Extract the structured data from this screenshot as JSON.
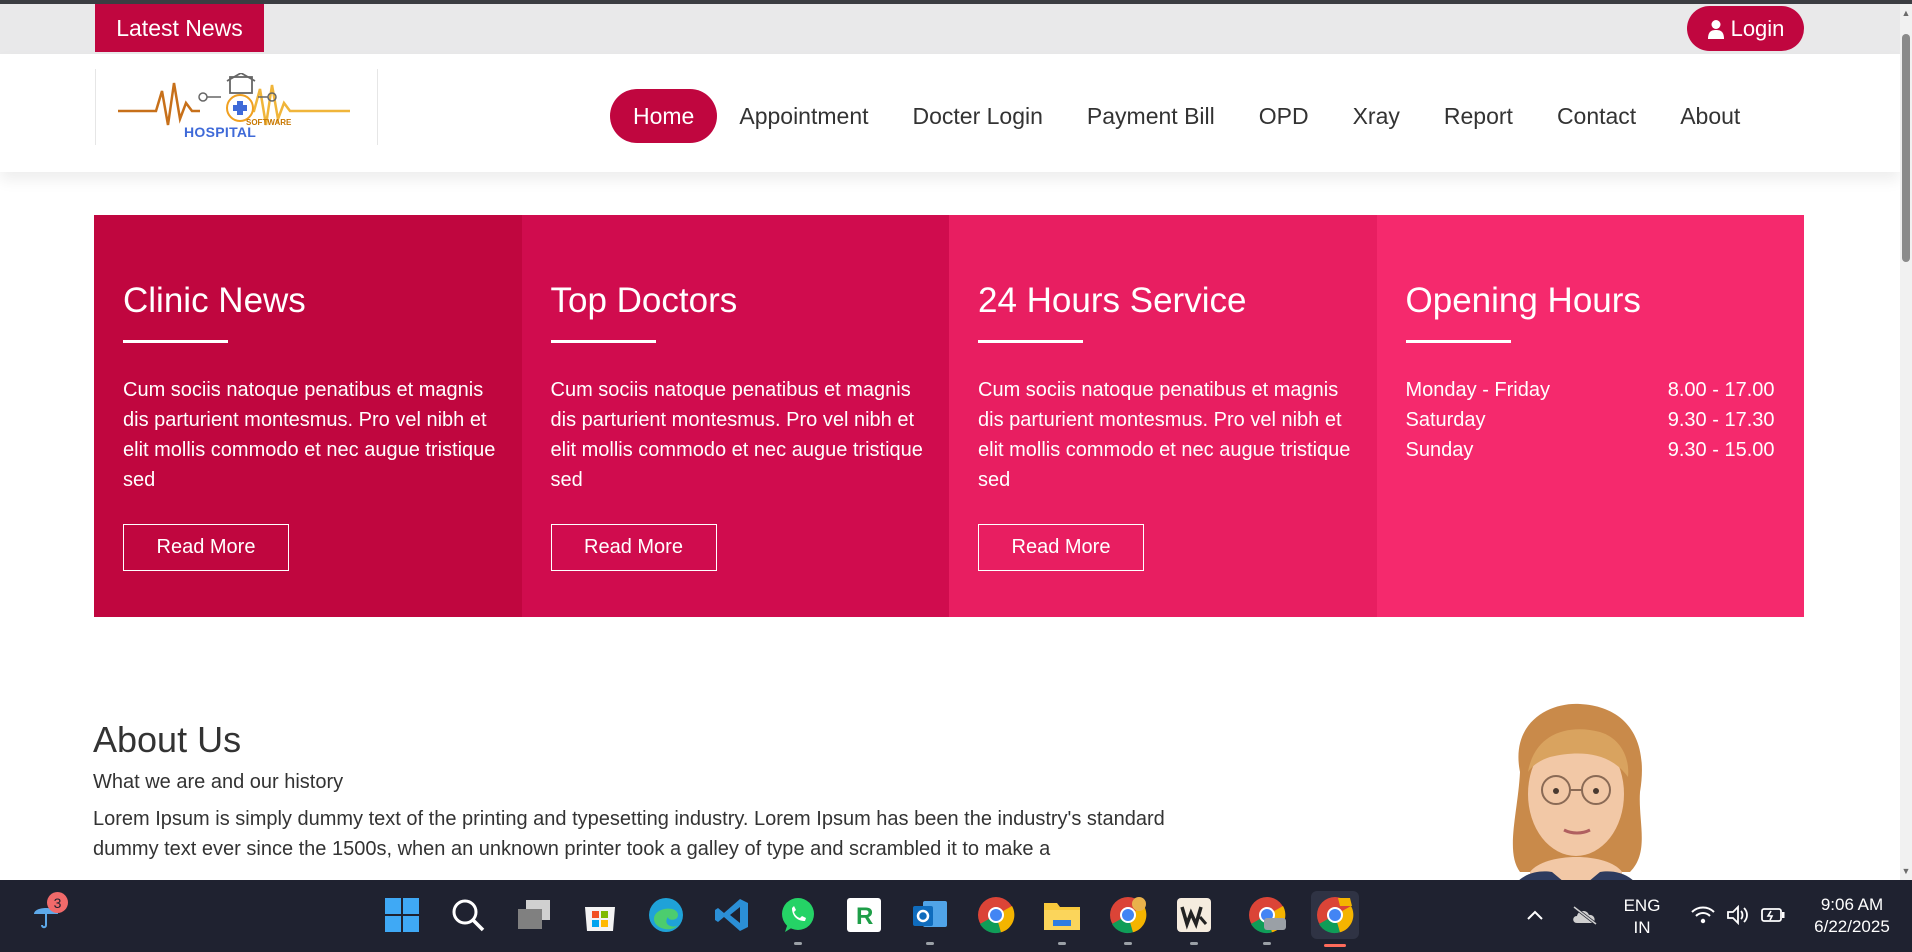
{
  "topbar": {
    "latest_news": "Latest News",
    "login": "Login"
  },
  "logo": {
    "word_main": "HOSPITAL",
    "word_sub": "SOFTWARE"
  },
  "nav": {
    "items": [
      {
        "label": "Home",
        "active": true
      },
      {
        "label": "Appointment",
        "active": false
      },
      {
        "label": "Docter Login",
        "active": false
      },
      {
        "label": "Payment Bill",
        "active": false
      },
      {
        "label": "OPD",
        "active": false
      },
      {
        "label": "Xray",
        "active": false
      },
      {
        "label": "Report",
        "active": false
      },
      {
        "label": "Contact",
        "active": false
      },
      {
        "label": "About",
        "active": false
      }
    ]
  },
  "features": [
    {
      "title": "Clinic News",
      "text": "Cum sociis natoque penatibus et magnis dis parturient montesmus. Pro vel nibh et elit mollis commodo et nec augue tristique sed",
      "button": "Read More",
      "color": "#c0063f"
    },
    {
      "title": "Top Doctors",
      "text": "Cum sociis natoque penatibus et magnis dis parturient montesmus. Pro vel nibh et elit mollis commodo et nec augue tristique sed",
      "button": "Read More",
      "color": "#d00c4e"
    },
    {
      "title": "24 Hours Service",
      "text": "Cum sociis natoque penatibus et magnis dis parturient montesmus. Pro vel nibh et elit mollis commodo et nec augue tristique sed",
      "button": "Read More",
      "color": "#e81e61"
    },
    {
      "title": "Opening Hours",
      "color": "#f5296d",
      "hours": [
        {
          "day": "Monday - Friday",
          "time": "8.00 - 17.00"
        },
        {
          "day": "Saturday",
          "time": "9.30 - 17.30"
        },
        {
          "day": "Sunday",
          "time": "9.30 - 15.00"
        }
      ]
    }
  ],
  "about": {
    "title": "About Us",
    "subtitle": "What we are and our history",
    "body": "Lorem Ipsum is simply dummy text of the printing and typesetting industry. Lorem Ipsum has been the industry's standard dummy text ever since the 1500s, when an unknown printer took a galley of type and scrambled it to make a"
  },
  "taskbar": {
    "weather_badge": "3",
    "lang_line1": "ENG",
    "lang_line2": "IN",
    "time": "9:06 AM",
    "date": "6/22/2025",
    "apps": [
      "windows-start",
      "search",
      "task-view",
      "microsoft-store",
      "edge",
      "vscode",
      "whatsapp",
      "r-app",
      "outlook",
      "chrome",
      "file-explorer",
      "chrome-profile",
      "wps-app",
      "chrome-test",
      "chrome-canary"
    ]
  },
  "colors": {
    "brand": "#c0063f",
    "taskbar": "#1f2230"
  }
}
